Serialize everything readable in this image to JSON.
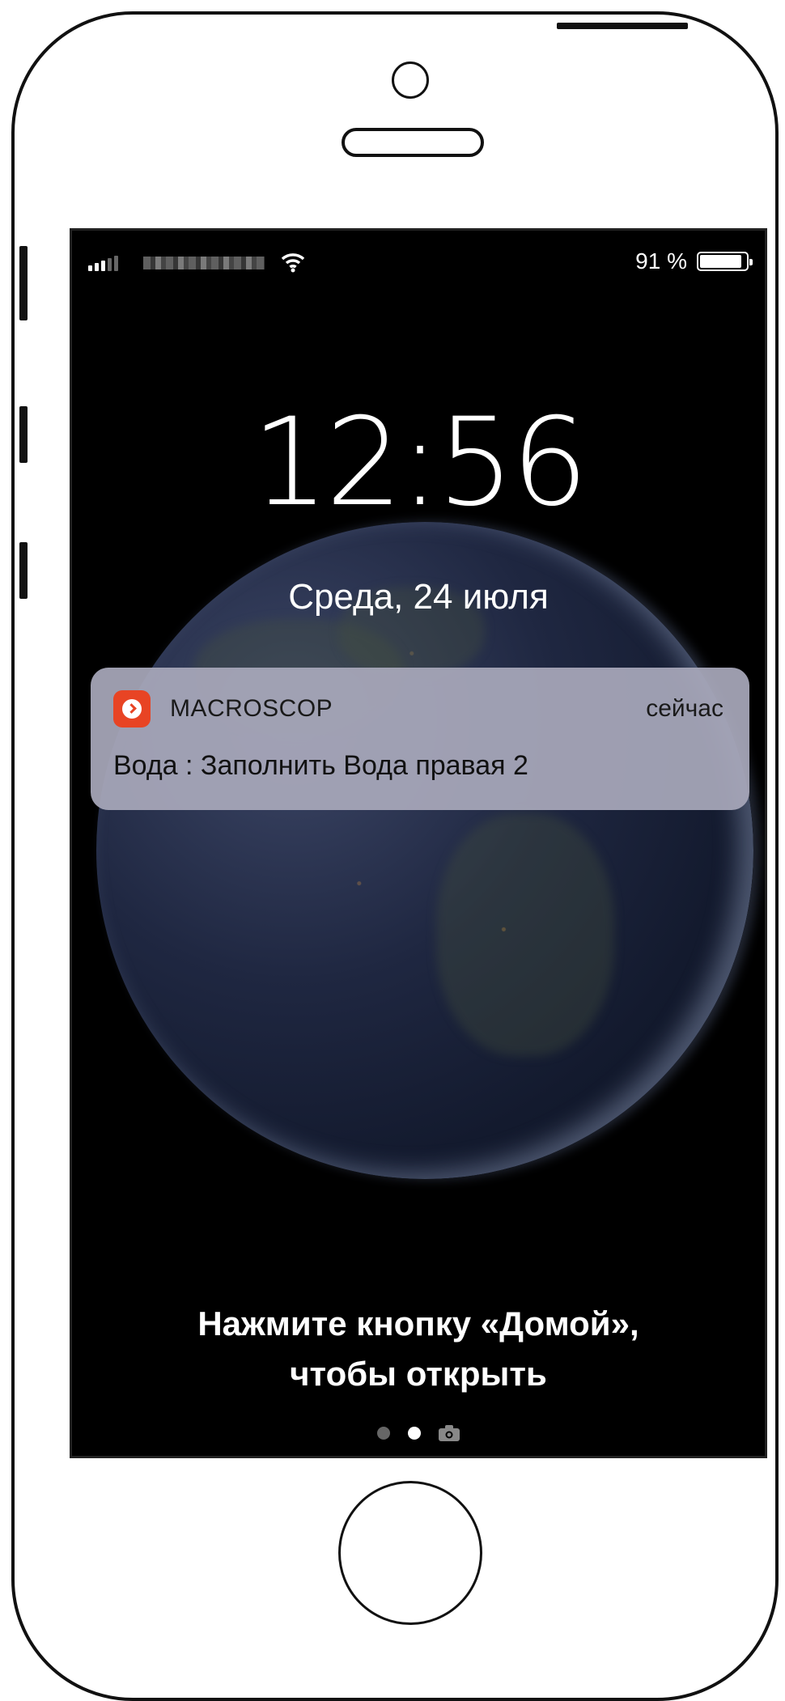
{
  "status_bar": {
    "battery_percent": "91 %",
    "battery_level": 0.91,
    "icons": [
      "signal-icon",
      "wifi-icon",
      "battery-icon"
    ]
  },
  "lock_screen": {
    "time": "12:56",
    "date": "Среда, 24 июля"
  },
  "notification": {
    "app_name": "MACROSCOP",
    "timestamp": "сейчас",
    "message": "Вода : Заполнить Вода правая 2",
    "icon": "macroscop-app-icon",
    "accent_color": "#e84424"
  },
  "unlock_hint": {
    "line1": "Нажмите кнопку «Домой»,",
    "line2": "чтобы открыть"
  },
  "page_indicator": {
    "pages": 2,
    "active": 2,
    "extra_icon": "camera-icon"
  }
}
